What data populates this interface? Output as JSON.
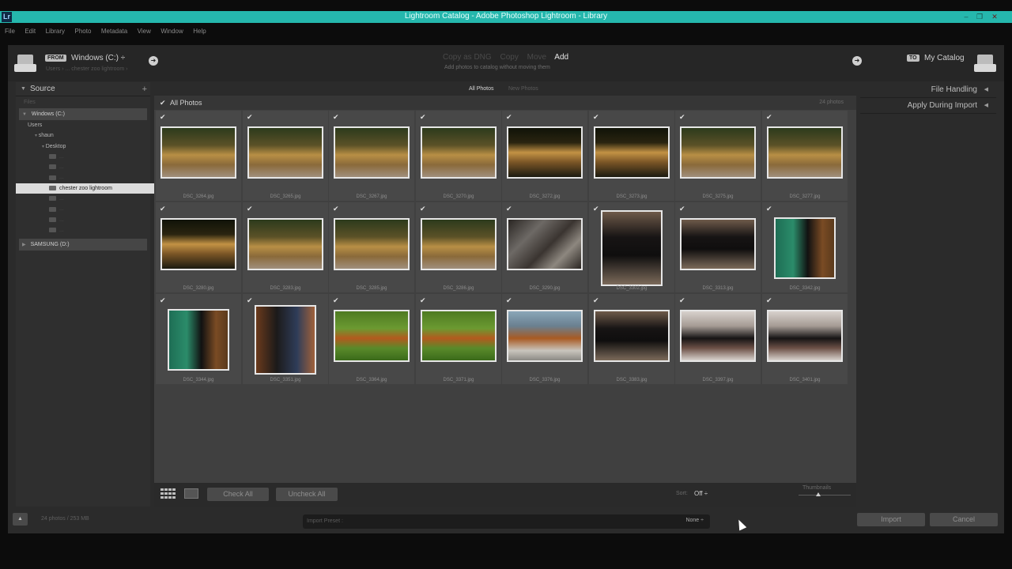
{
  "window": {
    "title": "Lightroom Catalog - Adobe Photoshop Lightroom - Library",
    "app_icon": "Lr",
    "titlebar_color": "#25b7ad"
  },
  "menu": [
    "File",
    "Edit",
    "Library",
    "Photo",
    "Metadata",
    "View",
    "Window",
    "Help"
  ],
  "header": {
    "from_tag": "FROM",
    "from_volume": "Windows (C:) ÷",
    "from_path": "Users › ... chester zoo lightroom ›",
    "modes": [
      "Copy as DNG",
      "Copy",
      "Move",
      "Add"
    ],
    "active_mode": "Add",
    "mode_hint": "Add photos to catalog without moving them",
    "to_tag": "TO",
    "to_catalog": "My Catalog"
  },
  "source": {
    "title": "Source",
    "files_label": "Files",
    "volume_c": "Windows (C:)",
    "tree": [
      {
        "label": "Users",
        "indent": 1
      },
      {
        "label": "shaun",
        "indent": 2
      },
      {
        "label": "Desktop",
        "indent": 3
      },
      {
        "label": "...",
        "indent": 4,
        "dim": true
      },
      {
        "label": "...",
        "indent": 4,
        "dim": true
      },
      {
        "label": "...",
        "indent": 4,
        "dim": true
      },
      {
        "label": "chester zoo lightroom",
        "indent": 4,
        "selected": true
      },
      {
        "label": "...",
        "indent": 4,
        "dim": true
      },
      {
        "label": "...",
        "indent": 4,
        "dim": true
      },
      {
        "label": "...",
        "indent": 4,
        "dim": true
      },
      {
        "label": "...",
        "indent": 4,
        "dim": true
      }
    ],
    "volume_d": "SAMSUNG (D:)"
  },
  "grid": {
    "tabs": [
      "All Photos",
      "New Photos"
    ],
    "active_tab": "All Photos",
    "header_label": "All Photos",
    "count_label": "24 photos",
    "photos": [
      {
        "file": "DSC_3264.jpg",
        "palette": "jaguar",
        "orient": "land"
      },
      {
        "file": "DSC_3265.jpg",
        "palette": "jaguar",
        "orient": "land"
      },
      {
        "file": "DSC_3267.jpg",
        "palette": "jaguar",
        "orient": "land"
      },
      {
        "file": "DSC_3270.jpg",
        "palette": "jaguar",
        "orient": "land"
      },
      {
        "file": "DSC_3272.jpg",
        "palette": "jaguar-dark",
        "orient": "land"
      },
      {
        "file": "DSC_3273.jpg",
        "palette": "jaguar-dark",
        "orient": "land"
      },
      {
        "file": "DSC_3275.jpg",
        "palette": "jaguar",
        "orient": "land"
      },
      {
        "file": "DSC_3277.jpg",
        "palette": "jaguar",
        "orient": "land"
      },
      {
        "file": "DSC_3280.jpg",
        "palette": "jaguar-dark",
        "orient": "land"
      },
      {
        "file": "DSC_3283.jpg",
        "palette": "jaguar",
        "orient": "land"
      },
      {
        "file": "DSC_3285.jpg",
        "palette": "jaguar",
        "orient": "land"
      },
      {
        "file": "DSC_3286.jpg",
        "palette": "jaguar",
        "orient": "land"
      },
      {
        "file": "DSC_3290.jpg",
        "palette": "wood",
        "orient": "land"
      },
      {
        "file": "DSC_3302.jpg",
        "palette": "bear",
        "orient": "port"
      },
      {
        "file": "DSC_3313.jpg",
        "palette": "bear",
        "orient": "land"
      },
      {
        "file": "DSC_3342.jpg",
        "palette": "bear-green",
        "orient": "port"
      },
      {
        "file": "DSC_3344.jpg",
        "palette": "bear-green",
        "orient": "port"
      },
      {
        "file": "DSC_3351.jpg",
        "palette": "bear-wood",
        "orient": "port"
      },
      {
        "file": "DSC_3364.jpg",
        "palette": "orangutan-green",
        "orient": "land"
      },
      {
        "file": "DSC_3371.jpg",
        "palette": "orangutan-green",
        "orient": "land"
      },
      {
        "file": "DSC_3376.jpg",
        "palette": "orangutan-sky",
        "orient": "land"
      },
      {
        "file": "DSC_3383.jpg",
        "palette": "bear",
        "orient": "land"
      },
      {
        "file": "DSC_3397.jpg",
        "palette": "bear-log",
        "orient": "land"
      },
      {
        "file": "DSC_3401.jpg",
        "palette": "bear-log",
        "orient": "land"
      }
    ]
  },
  "toolbar": {
    "check_all": "Check All",
    "uncheck_all": "Uncheck All",
    "sort_label": "Sort:",
    "sort_value": "Off ÷",
    "thumbnails_label": "Thumbnails"
  },
  "right": {
    "file_handling": "File Handling",
    "apply_during_import": "Apply During Import"
  },
  "footer": {
    "summary": "24 photos / 253 MB",
    "preset_label": "Import Preset :",
    "preset_value": "None ÷",
    "import": "Import",
    "cancel": "Cancel"
  }
}
